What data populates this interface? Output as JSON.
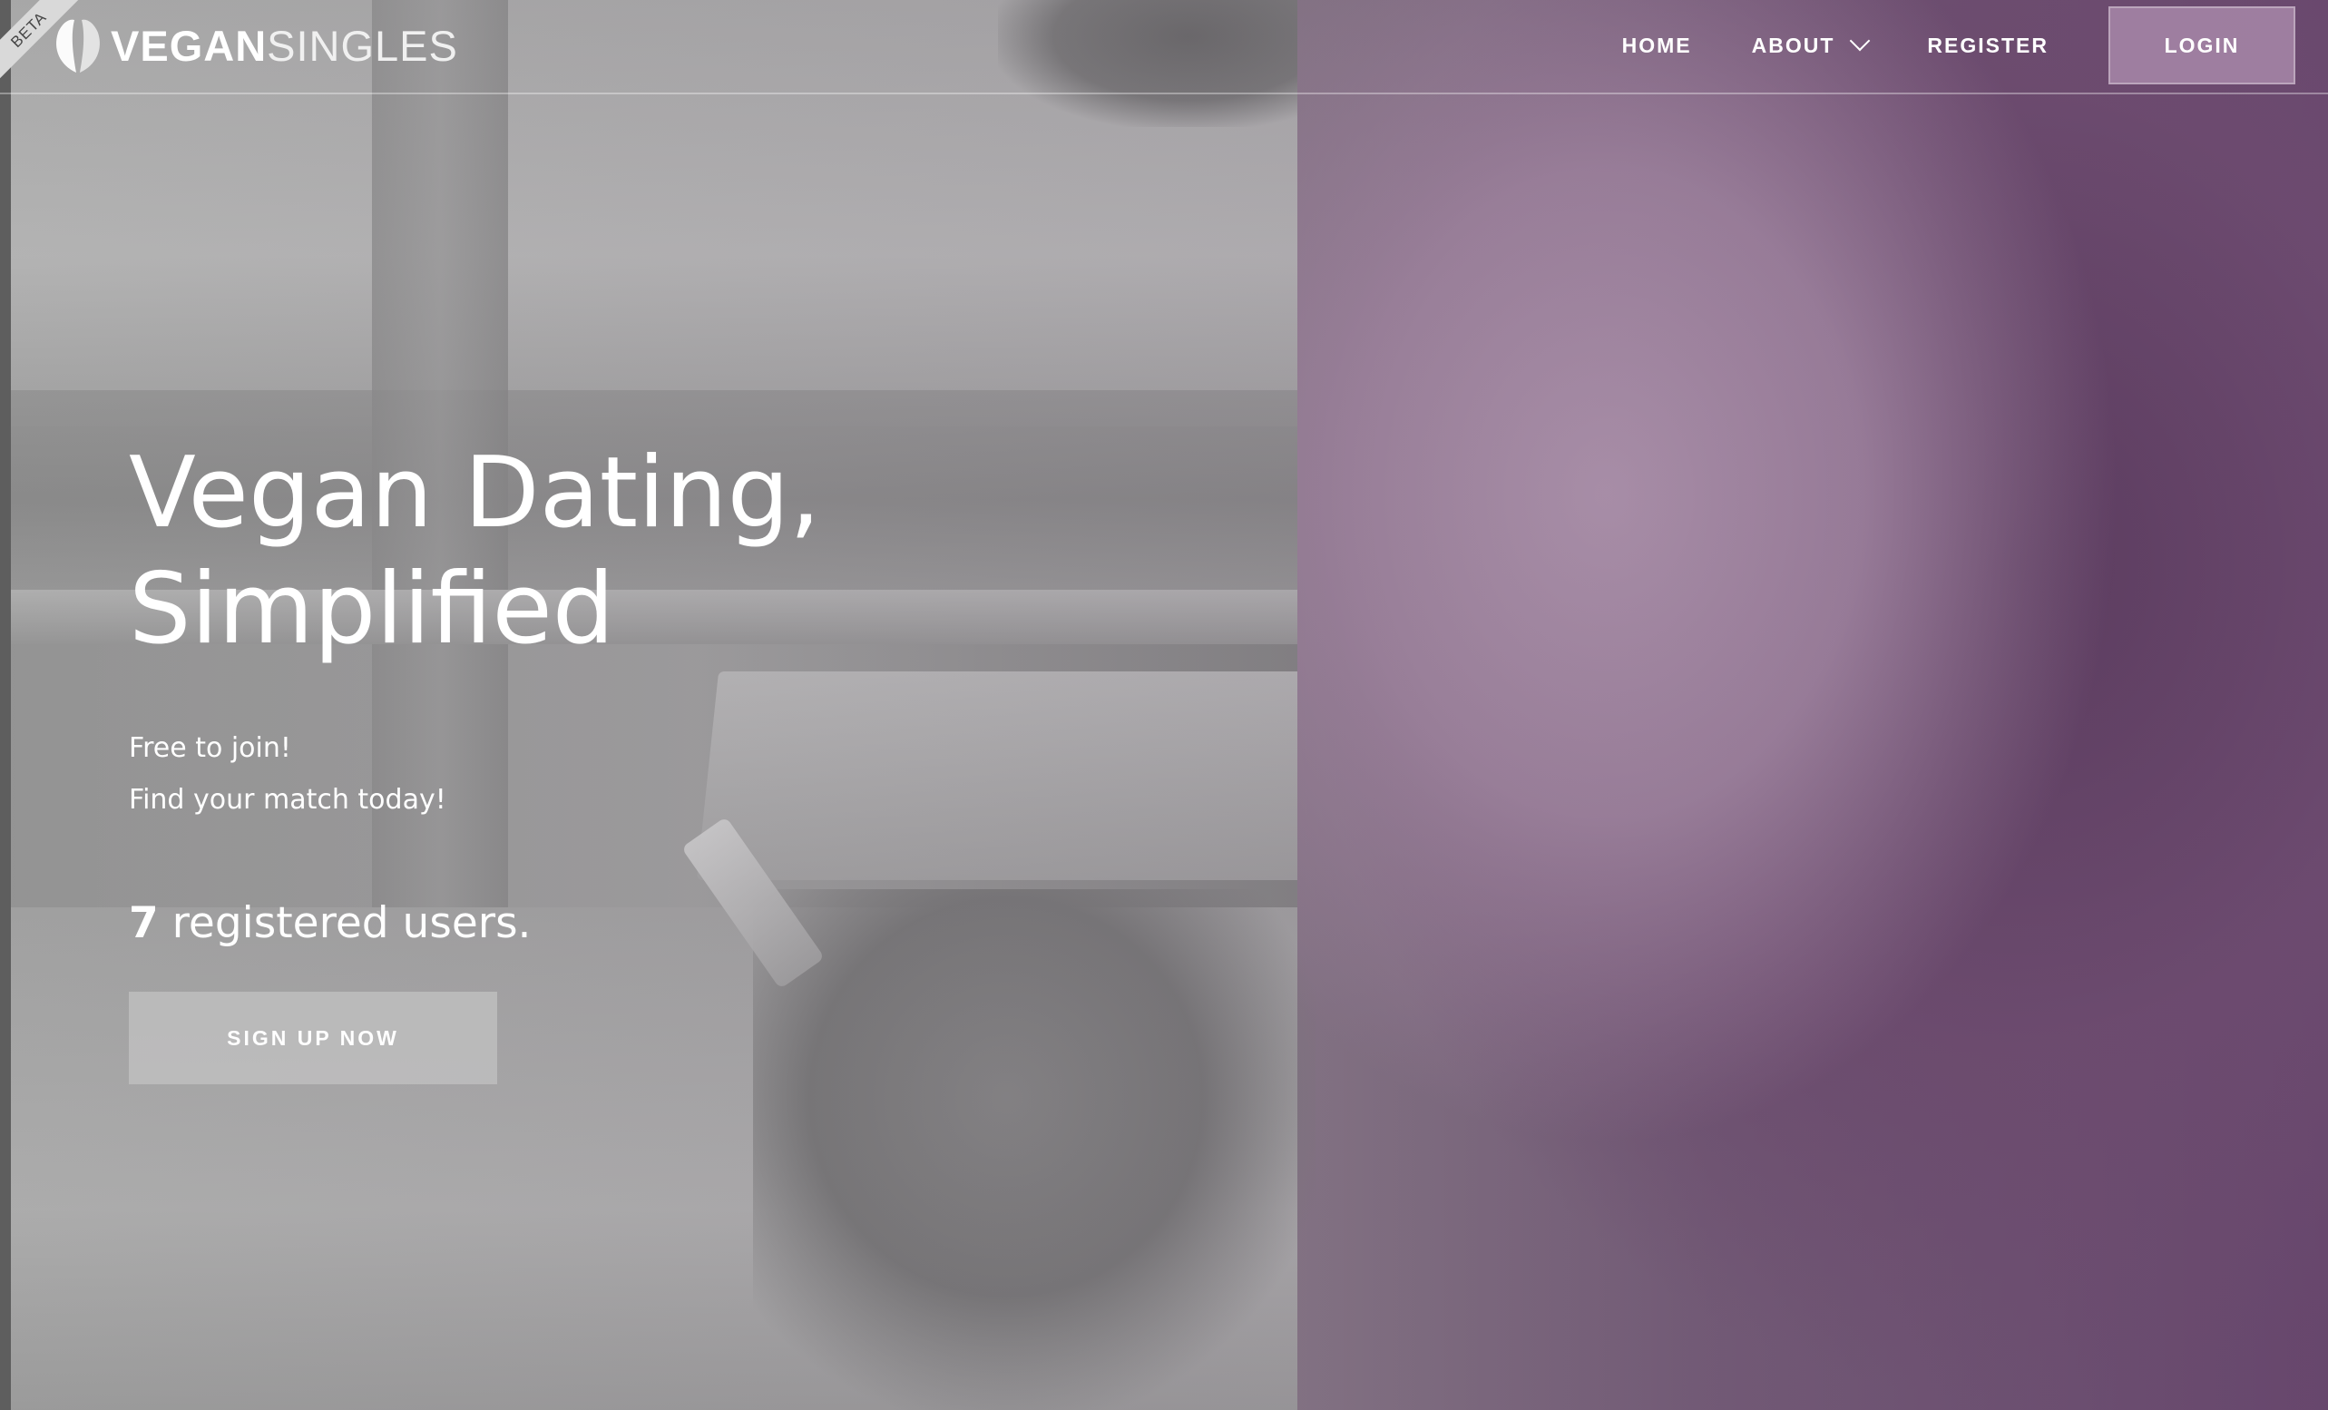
{
  "beta_badge": "BETA",
  "logo": {
    "text_bold": "VEGAN",
    "text_light": "SINGLES",
    "icon": "two-leaves-icon"
  },
  "nav": {
    "items": [
      {
        "label": "HOME"
      },
      {
        "label": "ABOUT",
        "has_dropdown": true,
        "icon": "chevron-down-icon"
      },
      {
        "label": "REGISTER"
      }
    ],
    "login_label": "LOGIN"
  },
  "hero": {
    "title_line1": "Vegan Dating,",
    "title_line2": "Simplified",
    "subtitle_line1": "Free to join!",
    "subtitle_line2": "Find your match today!",
    "user_count": "7",
    "user_suffix": " registered users.",
    "cta_label": "SIGN UP NOW"
  },
  "colors": {
    "accent": "#b89bb8",
    "button_bg": "#bebebe",
    "text": "#ffffff"
  }
}
